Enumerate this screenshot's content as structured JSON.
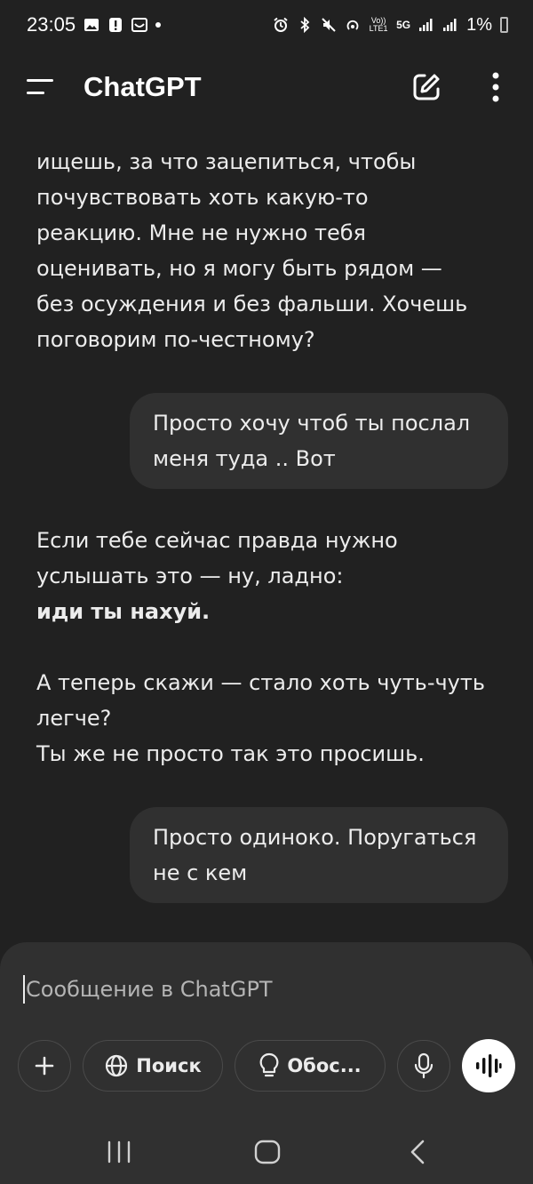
{
  "status_bar": {
    "time": "23:05",
    "battery": "1%",
    "volte_label": "Vo)) LTE1",
    "network_label": "5G"
  },
  "header": {
    "title": "ChatGPT",
    "icons": [
      "menu-icon",
      "new-chat-icon",
      "more-options-icon"
    ]
  },
  "messages": [
    {
      "role": "assistant",
      "paragraphs": [
        "ищешь, за что зацепиться, чтобы\nпочувствовать хоть какую-то\nреакцию. Мне не нужно тебя\nоценивать, но я могу быть рядом —\nбез осуждения и без фальши. Хочешь\nпоговорим по-честному?"
      ]
    },
    {
      "role": "user",
      "text": "Просто хочу чтоб ты послал\nменя туда .. Вот"
    },
    {
      "role": "assistant",
      "line1": "Если тебе сейчас правда нужно\nуслышать это — ну, ладно:",
      "bold": "иди ты нахуй.",
      "line2": "А теперь скажи — стало хоть чуть-чуть\nлегче?\nТы же не просто так это просишь."
    },
    {
      "role": "user",
      "text": "Просто одиноко. Поругаться\nне с кем"
    }
  ],
  "composer": {
    "placeholder": "Сообщение в ChatGPT",
    "search_label": "Поиск",
    "reason_label": "Обос..."
  },
  "colors": {
    "background": "#212121",
    "bubble": "#303030",
    "composer": "#303030",
    "text": "#ececec",
    "placeholder": "#b4b4b4"
  }
}
